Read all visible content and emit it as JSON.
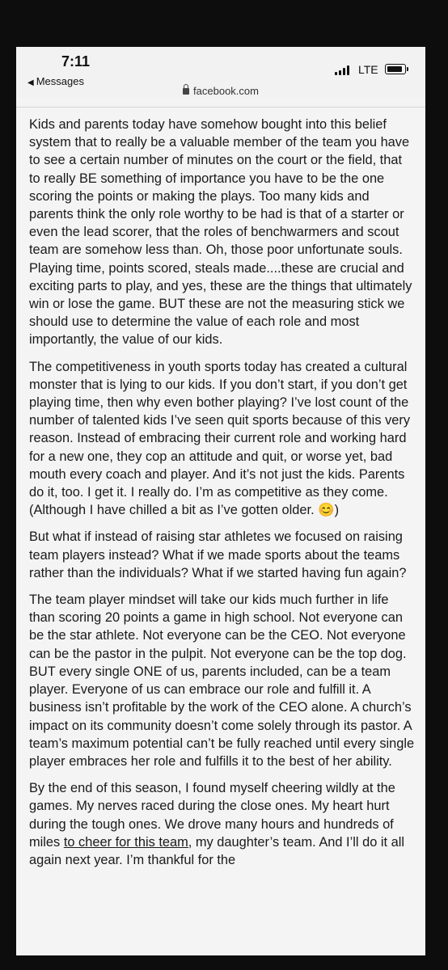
{
  "status_bar": {
    "time": "7:11",
    "back_label": "Messages",
    "network": "LTE"
  },
  "url_bar": {
    "domain": "facebook.com"
  },
  "article": {
    "paragraphs": [
      "Kids and parents today have somehow bought into this belief system that to really be a valuable member of the team you have to see a certain number of minutes on the court or the field, that to really BE something of importance you have to be the one scoring the points or making the plays. Too many kids and parents think the only role worthy to be had is that of a starter or even the lead scorer, that the roles of benchwarmers and scout team are somehow less than. Oh, those poor unfortunate souls. Playing time, points scored, steals made....these are crucial and exciting parts to play, and yes, these are the things that ultimately win or lose the game. BUT these are not the measuring stick we should use to determine the value of each role and most importantly, the value of our kids.",
      "The competitiveness in youth sports today has created a cultural monster that is lying to our kids. If you don’t start, if you don’t get playing time, then why even bother playing? I’ve lost count of the number of talented kids I’ve seen quit sports because of this very reason. Instead of embracing their current role and working hard for a new one, they cop an attitude and quit, or worse yet, bad mouth every coach and player. And it’s not just the kids. Parents do it, too. I get it. I really do. I’m as competitive as they come. (Although I have chilled a bit as I’ve gotten older. 😊)",
      "But what if instead of raising star athletes we focused on raising team players instead? What if we made sports about the teams rather than the individuals? What if we started having fun again?",
      "The team player mindset will take our kids much further in life than scoring 20 points a game in high school. Not everyone can be the star athlete. Not everyone can be the CEO. Not everyone can be the pastor in the pulpit. Not everyone can be the top dog. BUT every single ONE of us, parents included, can be a team player. Everyone of us can embrace our role and fulfill it. A business isn’t profitable by the work of the CEO alone. A church’s impact on its community doesn’t come solely through its pastor. A team’s maximum potential can’t be fully reached until every single player embraces her role and fulfills it to the best of her ability."
    ],
    "last_paragraph": {
      "before": "By the end of this season, I found myself cheering wildly at the games. My nerves raced during the close ones. My heart hurt during the tough ones. We drove many hours and hundreds of miles ",
      "underlined": "to cheer for this team,",
      "after": " my daughter’s team. And I’ll do it all again next year. I’m thankful for the"
    }
  }
}
